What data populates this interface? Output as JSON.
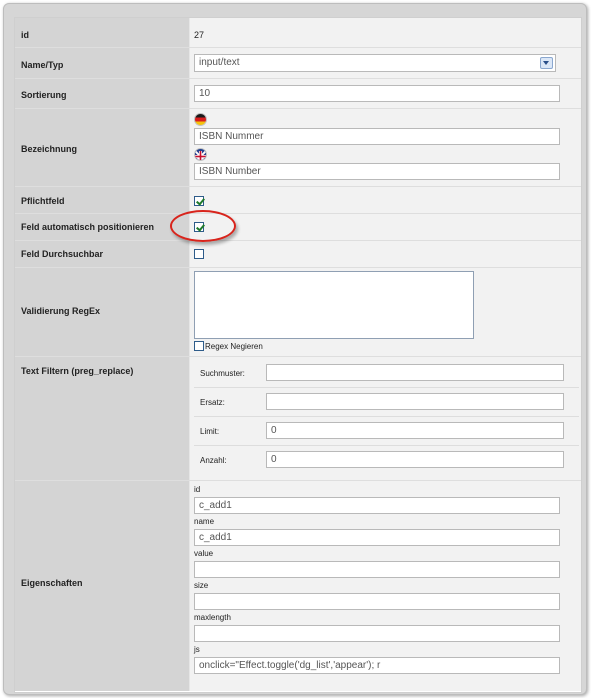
{
  "fields": {
    "id": {
      "label": "id",
      "value": "27"
    },
    "name_typ": {
      "label": "Name/Typ",
      "selected": "input/text"
    },
    "sortierung": {
      "label": "Sortierung",
      "value": "10"
    },
    "bezeichnung": {
      "label": "Bezeichnung",
      "de_value": "ISBN Nummer",
      "en_value": "ISBN Number"
    },
    "pflichtfeld": {
      "label": "Pflichtfeld",
      "checked": true
    },
    "auto_position": {
      "label": "Feld automatisch positionieren",
      "checked": true
    },
    "durchsuchbar": {
      "label": "Feld Durchsuchbar",
      "checked": false
    },
    "validierung": {
      "label": "Validierung RegEx",
      "value": "",
      "negieren_label": "Regex Negieren",
      "negieren_checked": false
    },
    "text_filter": {
      "label": "Text Filtern (preg_replace)",
      "rows": [
        {
          "label": "Suchmuster:",
          "value": ""
        },
        {
          "label": "Ersatz:",
          "value": ""
        },
        {
          "label": "Limit:",
          "value": "0"
        },
        {
          "label": "Anzahl:",
          "value": "0"
        }
      ]
    },
    "eigenschaften": {
      "label": "Eigenschaften",
      "props": [
        {
          "label": "id",
          "value": "c_add1"
        },
        {
          "label": "name",
          "value": "c_add1"
        },
        {
          "label": "value",
          "value": ""
        },
        {
          "label": "size",
          "value": ""
        },
        {
          "label": "maxlength",
          "value": ""
        },
        {
          "label": "js",
          "value": "onclick=\"Effect.toggle('dg_list','appear'); r"
        }
      ]
    }
  },
  "icons": {
    "de_flag": "germany-flag-icon",
    "en_flag": "uk-flag-icon",
    "dropdown": "chevron-down-icon"
  },
  "colors": {
    "highlight_ring": "#d8241c",
    "label_bg": "#d4d4d4",
    "value_bg": "#f2f2f2",
    "check": "#1f7a2b"
  }
}
